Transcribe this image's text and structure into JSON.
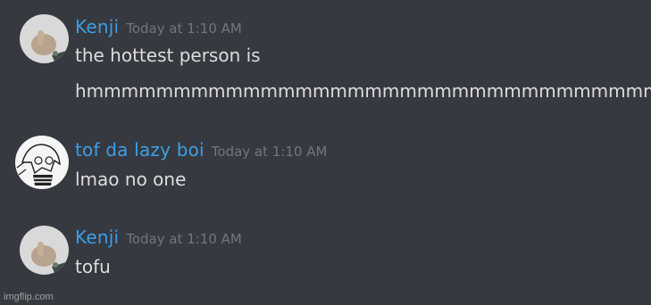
{
  "messages": [
    {
      "username": "Kenji",
      "timestamp": "Today at 1:10 AM",
      "lines": [
        "the hottest person is",
        "hmmmmmmmmmmmmmmmmmmmmmmmmmmmmmmmmmm"
      ],
      "avatar_icon": "thumbs-up-hand-avatar"
    },
    {
      "username": "tof da lazy boi",
      "timestamp": "Today at 1:10 AM",
      "lines": [
        "lmao no one"
      ],
      "avatar_icon": "anime-character-avatar"
    },
    {
      "username": "Kenji",
      "timestamp": "Today at 1:10 AM",
      "lines": [
        "tofu"
      ],
      "avatar_icon": "thumbs-up-hand-avatar"
    }
  ],
  "watermark": "imgflip.com",
  "colors": {
    "background": "#36393f",
    "username": "#3f9ee6",
    "timestamp": "#72767d",
    "message_text": "#dcddde"
  }
}
